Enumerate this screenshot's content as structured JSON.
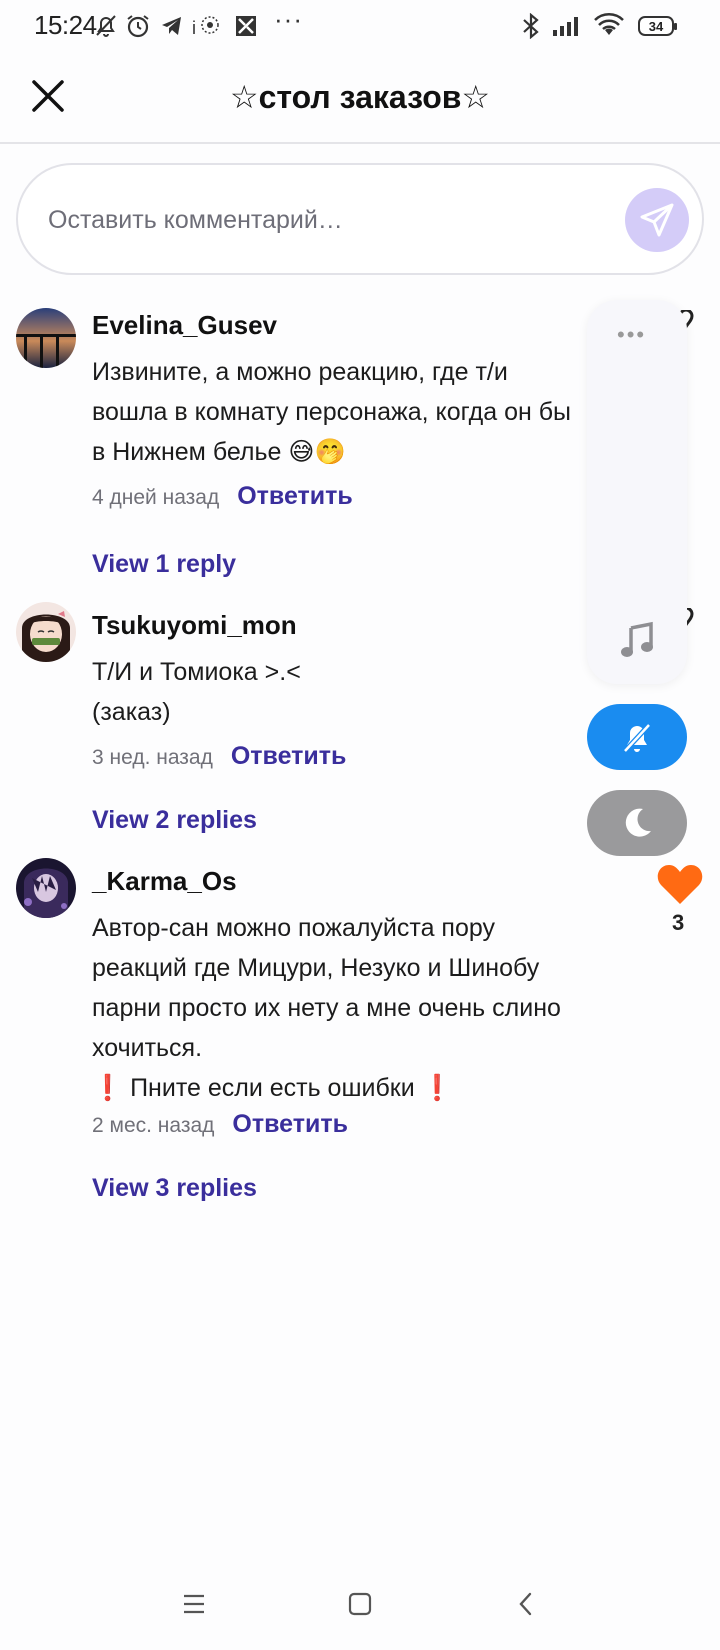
{
  "status_bar": {
    "time": "15:24",
    "battery": "34",
    "icons": [
      "bell-off-icon",
      "alarm-icon",
      "telegram-icon",
      "ip-icon",
      "app-icon",
      "more-dots-icon",
      "bluetooth-icon",
      "signal-icon",
      "wifi-icon"
    ]
  },
  "header": {
    "title": "☆стол заказов☆"
  },
  "comment_input": {
    "placeholder": "Оставить комментарий…"
  },
  "comments": [
    {
      "author": "Evelina_Gusev",
      "text_lines": [
        "Извините, а можно реакцию, где т/и",
        "вошла в комнату персонажа, когда он бы",
        "в Нижнем белье 😅🤭"
      ],
      "time": "4 дней назад",
      "reply": "Ответить",
      "view_replies": "View 1 reply"
    },
    {
      "author": "Tsukuyomi_mon",
      "text_lines": [
        "Т/И и Томиока >.<",
        "(заказ)"
      ],
      "time": "3 нед. назад",
      "reply": "Ответить",
      "view_replies": "View 2 replies"
    },
    {
      "author": "_Karma_Os",
      "text_lines": [
        "Автор-сан можно пожалуйста пору",
        "реакций где Мицури, Незуко и Шинобу",
        "парни просто их нету а мне очень слино",
        "хочиться.",
        "❗ Пните если есть ошибки ❗"
      ],
      "time": "2 мес. назад",
      "reply": "Ответить",
      "view_replies": "View 3 replies",
      "likes": "3"
    }
  ],
  "floating_panel": {
    "menu_icon": "more-dots-icon",
    "music_icon": "music-note-icon",
    "mute_icon": "bell-off-icon",
    "night_icon": "moon-icon"
  },
  "colors": {
    "accent_link": "#3a2e9c",
    "send_button": "#d4ccf8",
    "mute_button": "#1a8cf0",
    "night_button": "#9a9a9c",
    "heart": "#ff6a13"
  },
  "nav": [
    "menu-icon",
    "home-icon",
    "back-icon"
  ]
}
